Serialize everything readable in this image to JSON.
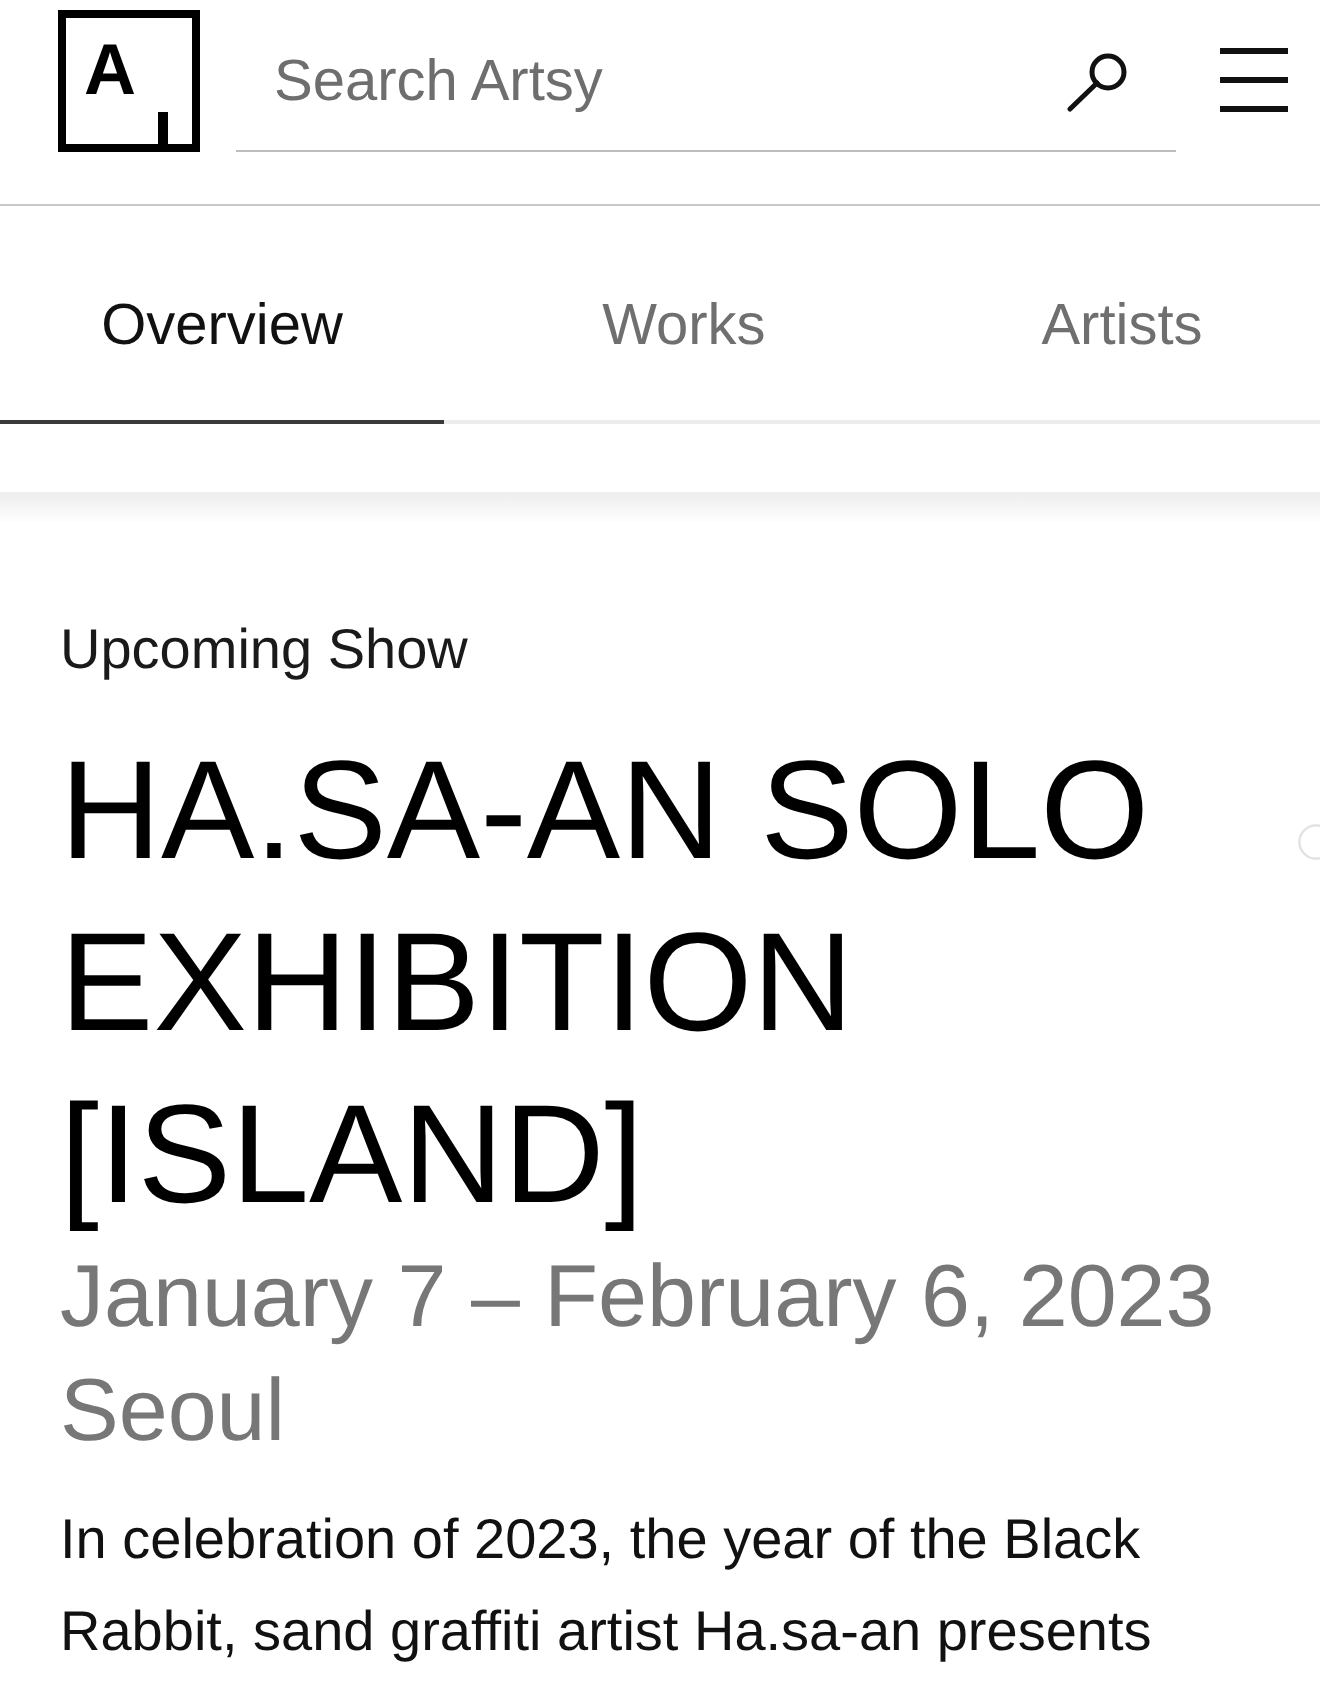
{
  "header": {
    "logo": {
      "letter": "A"
    },
    "search": {
      "placeholder": "Search Artsy"
    }
  },
  "tabs": [
    {
      "label": "Overview",
      "selected": true
    },
    {
      "label": "Works",
      "selected": false
    },
    {
      "label": "Artists",
      "selected": false
    }
  ],
  "show": {
    "status": "Upcoming Show",
    "title": "HA.SA-AN SOLO EXHIBITION [ISLAND]",
    "dates": "January 7 – February 6, 2023",
    "location": "Seoul",
    "description": "In celebration of 2023, the year of the Black Rabbit, sand graffiti artist Ha.sa-an presents"
  }
}
